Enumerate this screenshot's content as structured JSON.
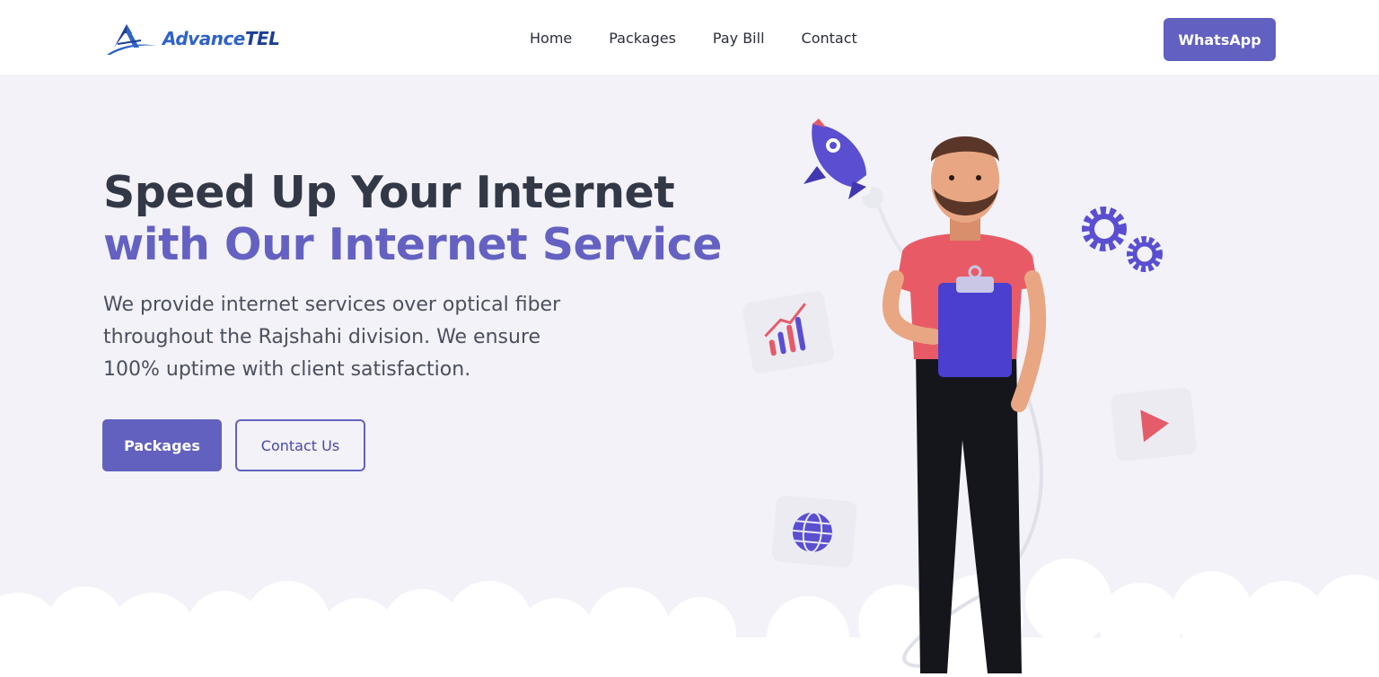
{
  "brand": {
    "name_part1": "Advance",
    "name_part2": "TEL",
    "logo_icon": "advancetel-logo-icon"
  },
  "nav": {
    "links": [
      "Home",
      "Packages",
      "Pay Bill",
      "Contact"
    ],
    "cta": "WhatsApp"
  },
  "hero": {
    "title_line1": "Speed Up Your Internet",
    "title_line2": "with Our Internet Service",
    "description": "We provide internet services over optical fiber throughout the Rajshahi division. We ensure 100% uptime with client satisfaction.",
    "primary_button": "Packages",
    "secondary_button": "Contact Us"
  },
  "illustration": {
    "icons": [
      "rocket-icon",
      "gears-icon",
      "chart-card-icon",
      "play-card-icon",
      "globe-card-icon",
      "man-with-clipboard"
    ]
  },
  "colors": {
    "accent": "#6260c0",
    "background": "#f2f2f8",
    "heading": "#333847",
    "logo_blue": "#2f63c9"
  }
}
